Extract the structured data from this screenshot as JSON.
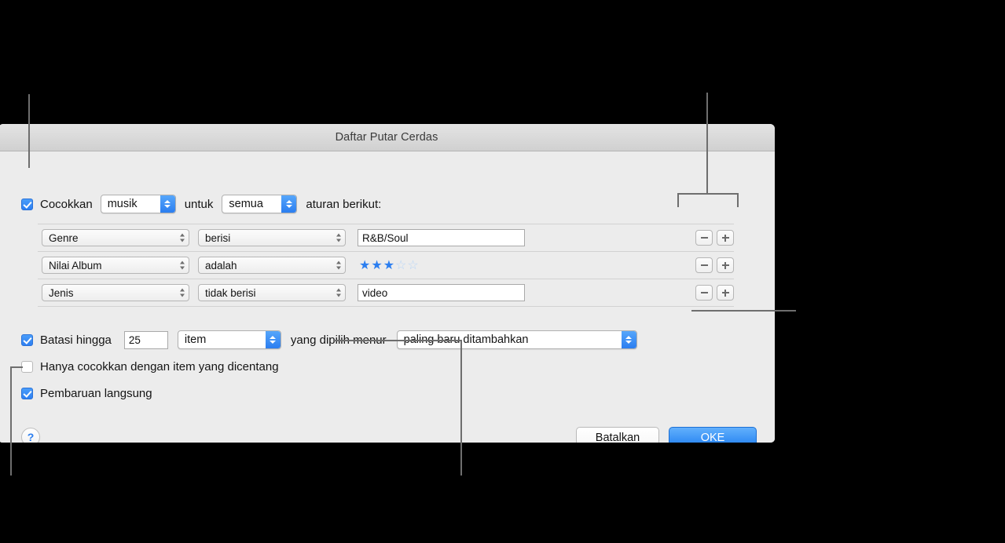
{
  "window": {
    "title": "Daftar Putar Cerdas"
  },
  "match_row": {
    "checkbox_checked": true,
    "label_prefix": "Cocokkan",
    "media_value": "musik",
    "label_middle": "untuk",
    "scope_value": "semua",
    "label_suffix": "aturan berikut:"
  },
  "rules": [
    {
      "field": "Genre",
      "operator": "berisi",
      "value_type": "text",
      "value": "R&B/Soul",
      "remove_label": "−",
      "add_label": "+"
    },
    {
      "field": "Nilai Album",
      "operator": "adalah",
      "value_type": "rating",
      "rating_filled": 3,
      "rating_total": 5,
      "star_filled_glyph": "★",
      "star_empty_glyph": "☆",
      "remove_label": "−",
      "add_label": "+"
    },
    {
      "field": "Jenis",
      "operator": "tidak berisi",
      "value_type": "text",
      "value": "video",
      "remove_label": "−",
      "add_label": "+"
    }
  ],
  "limit_row": {
    "checkbox_checked": true,
    "label": "Batasi hingga",
    "amount": "25",
    "unit_value": "item",
    "label_mid": "yang dipilih menur",
    "sort_value": "paling baru ditambahkan"
  },
  "checked_only_row": {
    "checkbox_checked": false,
    "label": "Hanya cocokkan dengan item yang dicentang"
  },
  "live_update_row": {
    "checkbox_checked": true,
    "label": "Pembaruan langsung"
  },
  "footer": {
    "help_label": "?",
    "cancel_label": "Batalkan",
    "ok_label": "OKE"
  },
  "colors": {
    "accent": "#2b7ef0",
    "window_bg": "#ececec",
    "titlebar_top": "#e4e4e4",
    "titlebar_bottom": "#d0d0d0",
    "callout": "#6e6e6e",
    "star_empty": "#b9d6f7"
  }
}
